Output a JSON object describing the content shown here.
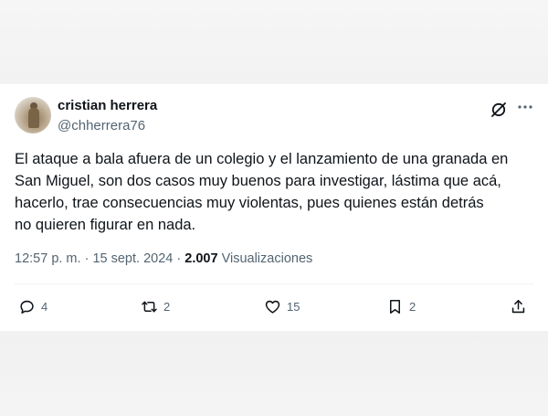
{
  "author": {
    "name": "cristian herrera",
    "handle": "@chherrera76"
  },
  "tweet": {
    "lines": [
      "El ataque a bala afuera de un colegio y el lanzamiento de una granada en",
      "San Miguel, son dos casos muy buenos para investigar, lástima que acá,",
      "hacerlo, trae consecuencias muy violentas, pues quienes están detrás",
      "no quieren figurar en nada."
    ],
    "time": "12:57 p. m.",
    "separator1": "·",
    "date": "15 sept. 2024",
    "separator2": "·",
    "views_count": "2.007",
    "views_label": "Visualizaciones"
  },
  "actions": {
    "replies": "4",
    "reposts": "2",
    "likes": "15",
    "bookmarks": "2"
  },
  "icons": {
    "reply": "reply-icon",
    "repost": "repost-icon",
    "like": "heart-icon",
    "bookmark": "bookmark-icon",
    "share": "share-icon",
    "grok": "grok-icon",
    "more": "more-icon"
  },
  "colors": {
    "text": "#0f1419",
    "secondary": "#536471",
    "background": "#ffffff"
  }
}
